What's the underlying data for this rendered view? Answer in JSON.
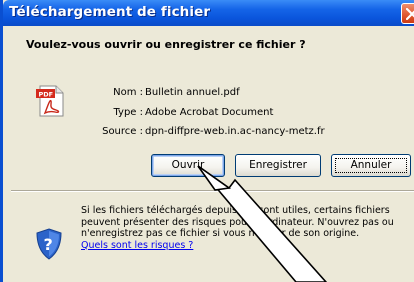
{
  "window": {
    "title": "Téléchargement de fichier"
  },
  "dialog": {
    "question": "Voulez-vous ouvrir ou enregistrer ce fichier ?",
    "file_icon": "pdf-file-icon",
    "fields": [
      {
        "label": "Nom :",
        "value": "Bulletin annuel.pdf"
      },
      {
        "label": "Type :",
        "value": "Adobe Acrobat Document"
      },
      {
        "label": "Source :",
        "value": "dpn-diffpre-web.in.ac-nancy-metz.fr"
      }
    ],
    "buttons": {
      "open": "Ouvrir",
      "save": "Enregistrer",
      "cancel": "Annuler"
    },
    "warning": {
      "icon": "shield-question-icon",
      "line1": "Si les fichiers téléchargés depuis In    t sont utiles, certains fichiers",
      "line2": "peuvent présenter des risques pour v    ordinateur. N'ouvrez pas ou",
      "line3": "n'enregistrez pas ce fichier si vous n'ête    ur de son origine.",
      "link": "Quels sont les risques ?"
    }
  },
  "colors": {
    "titlebar": "#0a55dc",
    "dialog_bg": "#ece9d8",
    "close": "#e0572f",
    "link": "#0000ee"
  }
}
